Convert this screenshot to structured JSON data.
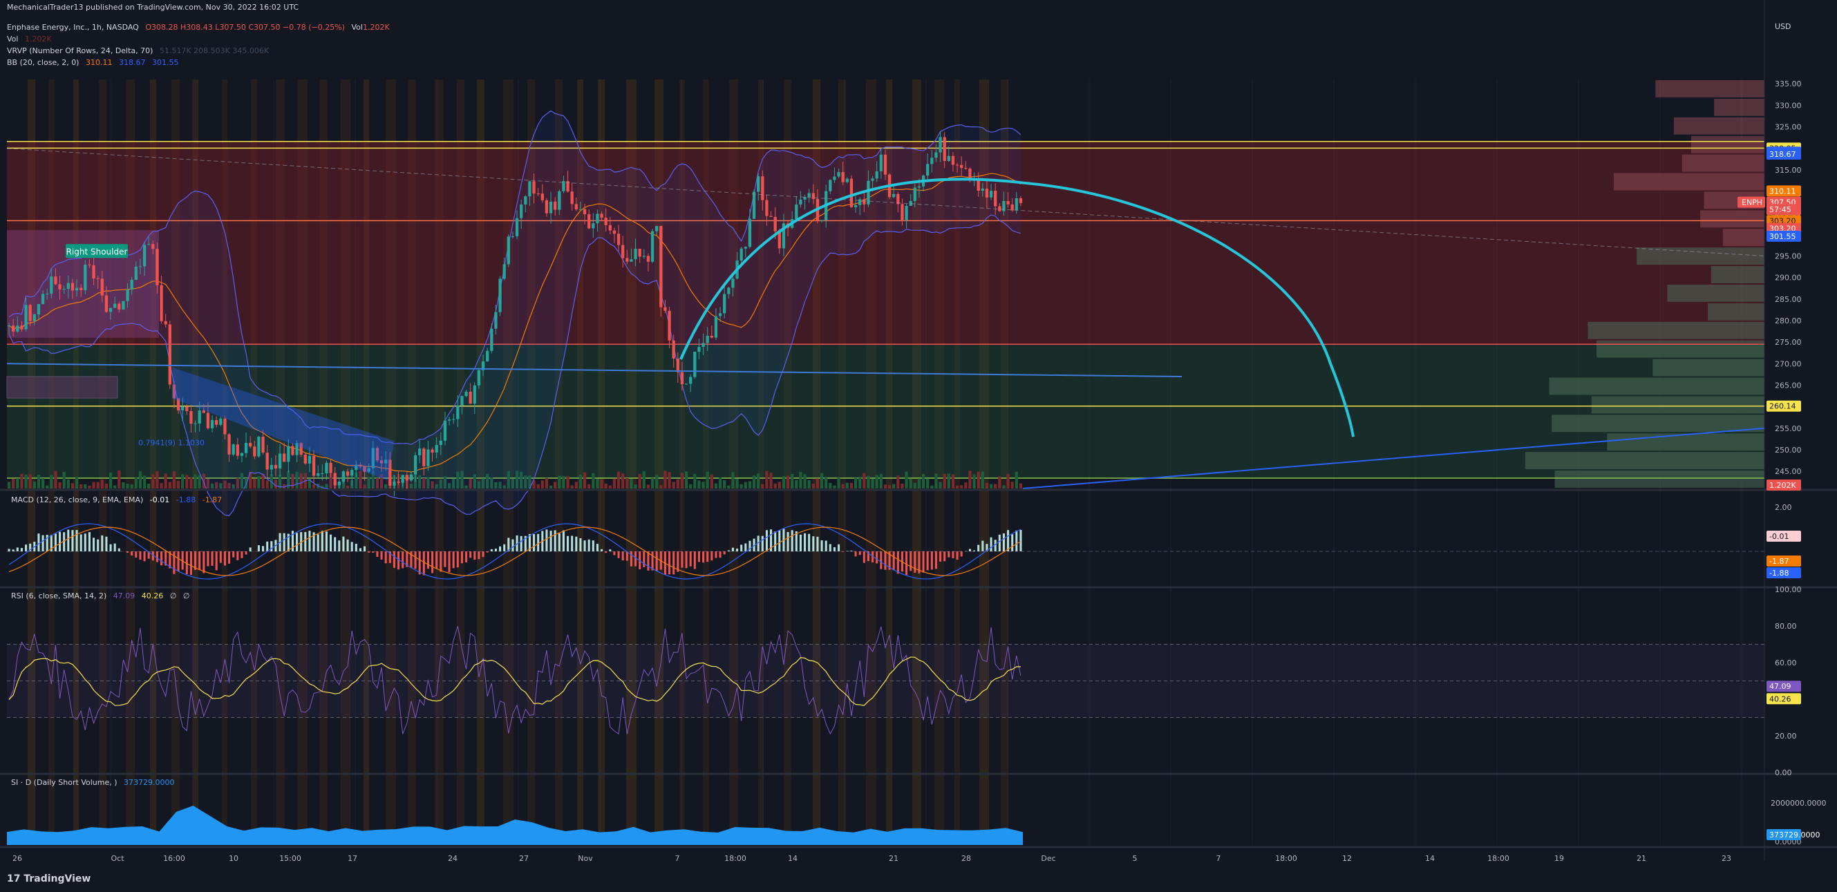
{
  "header": {
    "publisher_line": "MechanicalTrader13 published on TradingView.com, Nov 30, 2022 16:02 UTC",
    "symbol_line": "Enphase Energy, Inc., 1h, NASDAQ",
    "ohlc": "O308.28 H308.43 L307.50 C307.50 −0.78 (−0.25%)",
    "vol_label": "Vol",
    "vol_value": "1.202K",
    "vol_line_label": "Vol",
    "vol_line_value": "1.202K",
    "vrvp": "VRVP (Number Of Rows, 24, Delta, 70)",
    "vrvp_values": "51.517K  208.503K  345.006K",
    "bb": "BB (20, close, 2, 0)",
    "bb_values": [
      "310.11",
      "318.67",
      "301.55"
    ]
  },
  "colors": {
    "background": "#131722",
    "bull": "#26a69a",
    "bear": "#ef5350",
    "accent_blue": "#2962ff",
    "curve": "#26c6da",
    "bb_line": "#5b5ff0",
    "yellow": "#f7e34b",
    "orange": "#f57c00",
    "rsi": "#7e57c2"
  },
  "chart_data": [
    {
      "type": "candlestick",
      "title": "Enphase Energy, Inc., 1h, NASDAQ",
      "currency": "USD",
      "y_ticks": [
        "335.00",
        "330.00",
        "325.00",
        "320.00",
        "315.00",
        "310.00",
        "305.00",
        "300.00",
        "295.00",
        "290.00",
        "285.00",
        "280.00",
        "275.00",
        "270.00",
        "265.00",
        "260.00",
        "255.00",
        "250.00",
        "245.00"
      ],
      "ylim": [
        241,
        336
      ],
      "x_ticks": [
        "26",
        "Oct",
        "16:00",
        "10",
        "15:00",
        "17",
        "24",
        "27",
        "Nov",
        "7",
        "18:00",
        "14",
        "21",
        "28",
        "Dec",
        "5",
        "7",
        "18:00",
        "12",
        "14",
        "18:00",
        "19",
        "21",
        "23"
      ],
      "price_path": [
        [
          0,
          278
        ],
        [
          0.02,
          282
        ],
        [
          0.04,
          290
        ],
        [
          0.06,
          286
        ],
        [
          0.08,
          292
        ],
        [
          0.1,
          280
        ],
        [
          0.12,
          287
        ],
        [
          0.14,
          298
        ],
        [
          0.155,
          276
        ],
        [
          0.16,
          262
        ],
        [
          0.18,
          256
        ],
        [
          0.2,
          258
        ],
        [
          0.22,
          250
        ],
        [
          0.24,
          252
        ],
        [
          0.26,
          247
        ],
        [
          0.28,
          250
        ],
        [
          0.3,
          246
        ],
        [
          0.32,
          244
        ],
        [
          0.34,
          246
        ],
        [
          0.36,
          249
        ],
        [
          0.38,
          243
        ],
        [
          0.4,
          247
        ],
        [
          0.42,
          251
        ],
        [
          0.44,
          259
        ],
        [
          0.46,
          262
        ],
        [
          0.48,
          283
        ],
        [
          0.5,
          303
        ],
        [
          0.51,
          311
        ],
        [
          0.53,
          306
        ],
        [
          0.55,
          310
        ],
        [
          0.57,
          304
        ],
        [
          0.59,
          302
        ],
        [
          0.61,
          296
        ],
        [
          0.63,
          292
        ],
        [
          0.64,
          303
        ],
        [
          0.645,
          283
        ],
        [
          0.66,
          270
        ],
        [
          0.67,
          266
        ],
        [
          0.69,
          276
        ],
        [
          0.71,
          288
        ],
        [
          0.73,
          300
        ],
        [
          0.74,
          314
        ],
        [
          0.76,
          299
        ],
        [
          0.78,
          309
        ],
        [
          0.8,
          305
        ],
        [
          0.82,
          313
        ],
        [
          0.84,
          307
        ],
        [
          0.86,
          317
        ],
        [
          0.88,
          305
        ],
        [
          0.9,
          314
        ],
        [
          0.92,
          320
        ],
        [
          0.94,
          318
        ],
        [
          0.96,
          312
        ],
        [
          0.98,
          305
        ],
        [
          1.0,
          307.5
        ]
      ],
      "price_labels": [
        {
          "text": "320.05",
          "color": "#f7e34b",
          "text_color": "#131722",
          "price": 320.05
        },
        {
          "text": "319.12",
          "color": "#2962ff",
          "text_color": "#ffffff",
          "price": 319.12
        },
        {
          "text": "318.67",
          "color": "#2962ff",
          "text_color": "#ffffff",
          "price": 318.67
        },
        {
          "text": "310.11",
          "color": "#f57c00",
          "text_color": "#ffffff",
          "price": 310.11
        },
        {
          "text": "307.50",
          "color": "#ef5350",
          "text_color": "#ffffff",
          "price": 307.5
        },
        {
          "text": "57:45",
          "color": "#ef5350",
          "text_color": "#ffffff",
          "price": 305.8
        },
        {
          "text": "303.20",
          "color": "#f57c00",
          "text_color": "#131722",
          "price": 303.2
        },
        {
          "text": "303.20",
          "color": "#ef5350",
          "text_color": "#ffffff",
          "price": 301.4
        },
        {
          "text": "301.55",
          "color": "#2962ff",
          "text_color": "#ffffff",
          "price": 299.6
        },
        {
          "text": "260.14",
          "color": "#f7e34b",
          "text_color": "#131722",
          "price": 260.14
        },
        {
          "text": "1.202K",
          "color": "#ef5350",
          "text_color": "#ffffff",
          "price": 241.8
        }
      ],
      "symbol_badge": "ENPH",
      "horizontal_levels": [
        {
          "price": 321.6,
          "color": "#f7e34b"
        },
        {
          "price": 320.05,
          "color": "#f7e34b"
        },
        {
          "price": 303.2,
          "color": "#ff7043"
        },
        {
          "price": 274.5,
          "color": "#ef5350"
        },
        {
          "price": 260.14,
          "color": "#f7e34b"
        },
        {
          "price": 243.4,
          "color": "#8bc34a"
        }
      ],
      "annotations": [
        {
          "text": "Right Shoulder",
          "bg": "#089981",
          "color": "#ffffff"
        },
        {
          "text": "0.7941(9) 1.1030",
          "color": "#2962ff"
        }
      ],
      "projection_curve": "cyan arc from Nov 7 up to ~312 and falling to ~253 near Dec 12"
    },
    {
      "type": "histogram",
      "title": "MACD (12, 26, close, 9, EMA, EMA)",
      "values_text": [
        "-0.01",
        "-1.88",
        "-1.87"
      ],
      "y_ticks": [
        "2.00"
      ],
      "price_labels": [
        {
          "text": "-0.01",
          "color": "#ffcdd2",
          "text_color": "#131722"
        },
        {
          "text": "-1.87",
          "color": "#f57c00",
          "text_color": "#ffffff"
        },
        {
          "text": "-1.88",
          "color": "#2962ff",
          "text_color": "#ffffff"
        }
      ]
    },
    {
      "type": "line",
      "title": "RSI (6, close, SMA, 14, 2)",
      "values_text": [
        "47.09",
        "40.26",
        "∅",
        "∅"
      ],
      "y_ticks": [
        "100.00",
        "80.00",
        "60.00",
        "20.00",
        "0.00"
      ],
      "ylim": [
        0,
        100
      ],
      "bands": [
        70,
        50,
        30
      ],
      "price_labels": [
        {
          "text": "47.09",
          "color": "#7e57c2",
          "text_color": "#ffffff",
          "value": 47.09
        },
        {
          "text": "40.26",
          "color": "#f7e34b",
          "text_color": "#131722",
          "value": 40.26
        }
      ]
    },
    {
      "type": "area",
      "title": "SI · D (Daily Short Volume, )",
      "values_text": [
        "373729.0000"
      ],
      "y_ticks": [
        "2000000.0000",
        "0.0000"
      ],
      "price_labels": [
        {
          "text": "373729.0000",
          "color": "#2196f3",
          "text_color": "#ffffff"
        }
      ]
    }
  ],
  "footer": {
    "logo_glyph": "17",
    "brand": "TradingView"
  }
}
